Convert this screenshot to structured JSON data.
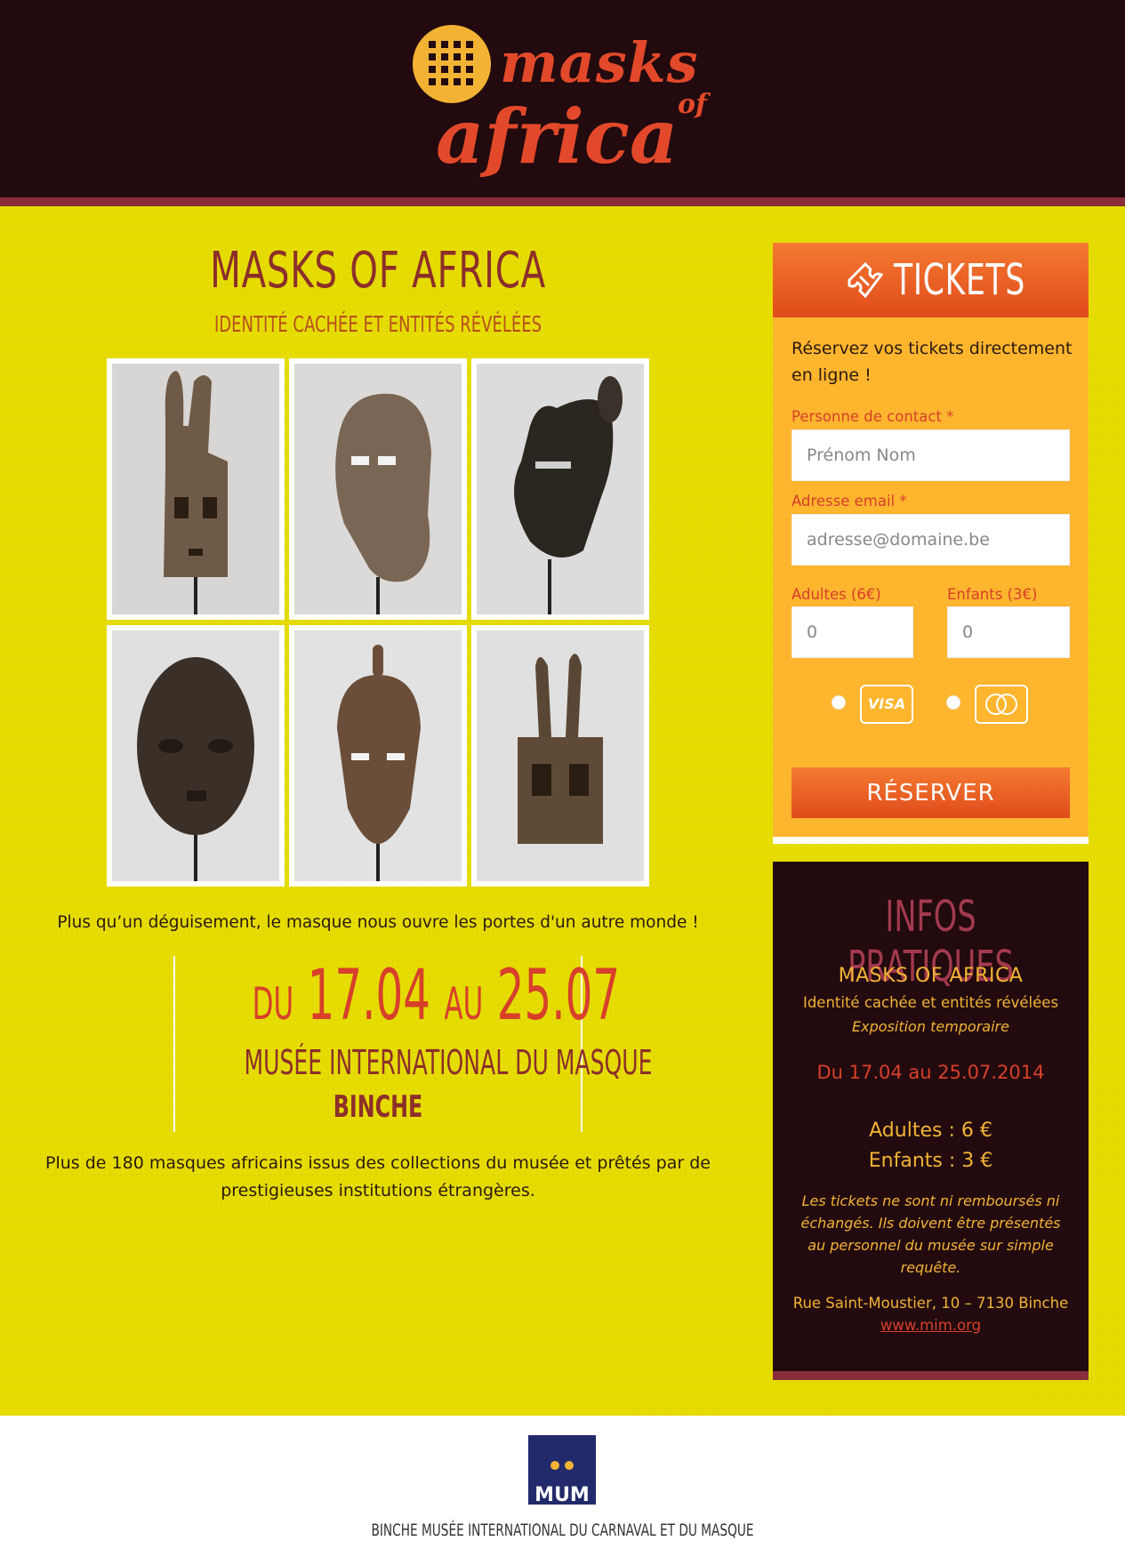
{
  "header": {
    "logo_text": {
      "line1": "masks",
      "line2": "of",
      "line3": "africa"
    },
    "colors": {
      "background": "#220a0e",
      "logo": "#e2492a",
      "emblem": "#f2b335"
    }
  },
  "main": {
    "title": "MASKS OF AFRICA",
    "subtitle": "IDENTITÉ CACHÉE ET ENTITÉS RÉVÉLÉES",
    "gallery": [
      {
        "alt": "Mask with long ears"
      },
      {
        "alt": "Mask with long beak-like snout"
      },
      {
        "alt": "Dark animal mask with ears"
      },
      {
        "alt": "Dark round face mask"
      },
      {
        "alt": "Carved face mask with crest"
      },
      {
        "alt": "Mask with two horns"
      }
    ],
    "tagline": "Plus qu’un déguisement, le masque nous ouvre les portes d'un autre monde !",
    "date_prefix": "DU",
    "date_start": "17.04",
    "date_mid": "AU",
    "date_end": "25.07",
    "museum": "MUSÉE INTERNATIONAL DU MASQUE",
    "city": "BINCHE",
    "description": "Plus de 180 masques africains issus des collections du musée et prêtés par de prestigieuses institutions étrangères."
  },
  "tickets": {
    "title": "TICKETS",
    "intro": "Réservez vos tickets directement en ligne !",
    "contact_label": "Personne de contact *",
    "contact_placeholder": "Prénom Nom",
    "email_label": "Adresse email *",
    "email_placeholder": "adresse@domaine.be",
    "adults_label": "Adultes (6€)",
    "adults_placeholder": "0",
    "children_label": "Enfants (3€)",
    "children_placeholder": "0",
    "visa_label": "VISA",
    "reserve_label": "RÉSERVER",
    "icons": {
      "ticket": "ticket-icon",
      "visa": "visa-card-icon",
      "mastercard": "mastercard-icon"
    }
  },
  "infos": {
    "title": "INFOS PRATIQUES",
    "name": "MASKS OF AFRICA",
    "subtitle": "Identité cachée et entités révélées",
    "type": "Exposition temporaire",
    "dates": "Du 17.04 au 25.07.2014",
    "adults": "Adultes : 6 €",
    "children": "Enfants : 3 €",
    "note": "Les tickets ne sont ni remboursés ni échangés. Ils doivent être présentés au personnel du musée sur simple requête.",
    "address": "Rue Saint-Moustier, 10 – 7130 Binche",
    "link": "www.mim.org"
  },
  "footer": {
    "logo_text": "MUM",
    "text": "BINCHE MUSÉE INTERNATIONAL DU CARNAVAL ET DU MASQUE"
  }
}
